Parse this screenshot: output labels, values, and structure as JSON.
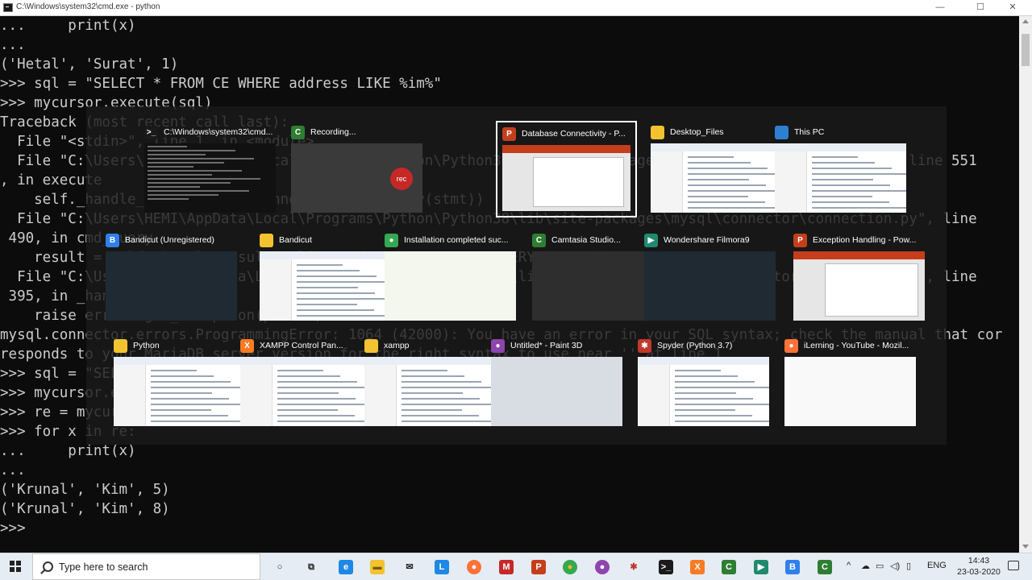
{
  "window": {
    "title": "C:\\Windows\\system32\\cmd.exe - python",
    "controls": {
      "minimize": "—",
      "maximize": "☐",
      "close": "✕"
    }
  },
  "console": {
    "lines": [
      "...     print(x)",
      "...",
      "('Hetal', 'Surat', 1)",
      ">>> sql = \"SELECT * FROM CE WHERE address LIKE %im%\"",
      ">>> mycursor.execute(sql)",
      "Traceback (most recent call last):",
      "  File \"<stdin>\", line 1, in <module>",
      "  File \"C:\\Users\\HEMI\\AppData\\Local\\Programs\\Python\\Python38\\lib\\site-packages\\mysql\\connector\\cursor.py\", line 551",
      ", in execute",
      "    self._handle_result(self._connection.cmd_query(stmt))",
      "  File \"C:\\Users\\HEMI\\AppData\\Local\\Programs\\Python\\Python38\\lib\\site-packages\\mysql\\connector\\connection.py\", line",
      " 490, in cmd_query",
      "    result = self._handle_result(self._send_cmd(ServerCmd.QUERY, query))",
      "  File \"C:\\Users\\HEMI\\AppData\\Local\\Programs\\Python\\Python38\\lib\\site-packages\\mysql\\connector\\connection.py\", line",
      " 395, in _handle_result",
      "    raise errors.get_exception(packet)",
      "mysql.connector.errors.ProgrammingError: 1064 (42000): You have an error in your SQL syntax; check the manual that cor",
      "responds to your MariaDB server version for the right syntax to use near '' at line 1",
      ">>> sql = \"SELECT * FROM CE WHERE address LIKE '%im%'\"",
      ">>> mycursor.execute(sql)",
      ">>> re = mycursor.fetchall()",
      ">>> for x in re:",
      "...     print(x)",
      "...",
      "('Krunal', 'Kim', 5)",
      "('Krunal', 'Kim', 8)",
      ">>>"
    ]
  },
  "switcher": {
    "windows": [
      {
        "label": "C:\\Windows\\system32\\cmd...",
        "icon": "cmd-icon",
        "thumb": "cmd",
        "color": "#1a1a1a",
        "glyph": ">_"
      },
      {
        "label": "Recording...",
        "icon": "camtasia-recorder-icon",
        "thumb": "rec",
        "color": "#2e7d32",
        "glyph": "C"
      },
      {
        "label": "Database Connectivity - P...",
        "icon": "powerpoint-icon",
        "thumb": "ppt",
        "color": "#c43e1c",
        "glyph": "P",
        "selected": true
      },
      {
        "label": "Desktop_Files",
        "icon": "folder-icon",
        "thumb": "white",
        "color": "#f2c230",
        "glyph": ""
      },
      {
        "label": "This PC",
        "icon": "this-pc-icon",
        "thumb": "white",
        "color": "#2f7fd1",
        "glyph": ""
      },
      {
        "label": "Bandicut (Unregistered)",
        "icon": "bandicut-icon",
        "thumb": "dark",
        "color": "#2f80ed",
        "glyph": "B"
      },
      {
        "label": "Bandicut",
        "icon": "folder-icon",
        "thumb": "white",
        "color": "#f2c230",
        "glyph": ""
      },
      {
        "label": "Installation completed suc...",
        "icon": "chrome-icon",
        "thumb": "green",
        "color": "#34a853",
        "glyph": "●"
      },
      {
        "label": "Camtasia Studio...",
        "icon": "camtasia-icon",
        "thumb": "dark2",
        "color": "#2e7d32",
        "glyph": "C"
      },
      {
        "label": "Wondershare Filmora9",
        "icon": "filmora-icon",
        "thumb": "dark",
        "color": "#1f8a70",
        "glyph": "▶"
      },
      {
        "label": "Exception Handling - Pow...",
        "icon": "powerpoint-icon",
        "thumb": "ppt",
        "color": "#c43e1c",
        "glyph": "P"
      },
      {
        "label": "Python",
        "icon": "folder-icon",
        "thumb": "white",
        "color": "#f2c230",
        "glyph": ""
      },
      {
        "label": "XAMPP Control Pan...",
        "icon": "xampp-icon",
        "thumb": "white",
        "color": "#fb7a24",
        "glyph": "X"
      },
      {
        "label": "xampp",
        "icon": "folder-icon",
        "thumb": "white",
        "color": "#f2c230",
        "glyph": ""
      },
      {
        "label": "Untitled* - Paint 3D",
        "icon": "paint3d-icon",
        "thumb": "paint",
        "color": "#8e44ad",
        "glyph": "●"
      },
      {
        "label": "Spyder (Python 3.7)",
        "icon": "spyder-icon",
        "thumb": "white",
        "color": "#c0392b",
        "glyph": "✱"
      },
      {
        "label": "iLerning - YouTube - Mozil...",
        "icon": "firefox-icon",
        "thumb": "yt",
        "color": "#ff7139",
        "glyph": "●"
      }
    ]
  },
  "taskbar": {
    "search_placeholder": "Type here to search",
    "apps": [
      {
        "name": "cortana-icon",
        "glyph": "○",
        "color": "transparent",
        "fg": "#222"
      },
      {
        "name": "task-view-icon",
        "glyph": "⧉",
        "color": "transparent",
        "fg": "#222"
      },
      {
        "name": "edge-icon",
        "glyph": "e",
        "color": "#1e88e5",
        "fg": "#fff"
      },
      {
        "name": "file-explorer-icon",
        "glyph": "▬",
        "color": "#f2c230",
        "fg": "#7a5d00"
      },
      {
        "name": "mail-icon",
        "glyph": "✉",
        "color": "transparent",
        "fg": "#222"
      },
      {
        "name": "lightshot-icon",
        "glyph": "L",
        "color": "#1e88e5",
        "fg": "#fff"
      },
      {
        "name": "firefox-icon",
        "glyph": "●",
        "color": "#ff7139",
        "fg": "#fff"
      },
      {
        "name": "mcafee-icon",
        "glyph": "M",
        "color": "#c62828",
        "fg": "#fff"
      },
      {
        "name": "powerpoint-icon",
        "glyph": "P",
        "color": "#c43e1c",
        "fg": "#fff"
      },
      {
        "name": "chrome-icon",
        "glyph": "●",
        "color": "#34a853",
        "fg": "#fbbc05"
      },
      {
        "name": "paint3d-icon",
        "glyph": "●",
        "color": "#8e44ad",
        "fg": "#fff"
      },
      {
        "name": "spyder-icon",
        "glyph": "✱",
        "color": "transparent",
        "fg": "#c0392b"
      },
      {
        "name": "cmd-icon",
        "glyph": ">_",
        "color": "#1a1a1a",
        "fg": "#fff"
      },
      {
        "name": "xampp-icon",
        "glyph": "X",
        "color": "#fb7a24",
        "fg": "#fff"
      },
      {
        "name": "camtasia-icon",
        "glyph": "C",
        "color": "#2e7d32",
        "fg": "#fff"
      },
      {
        "name": "filmora-icon",
        "glyph": "▶",
        "color": "#1f8a70",
        "fg": "#fff"
      },
      {
        "name": "firefox-icon-2",
        "glyph": "●",
        "color": "#ff7139",
        "fg": "#fff"
      },
      {
        "name": "bandicut-icon",
        "glyph": "B",
        "color": "#2f80ed",
        "fg": "#fff"
      },
      {
        "name": "camtasia-recorder-icon",
        "glyph": "C",
        "color": "#2e7d32",
        "fg": "#fff"
      }
    ],
    "tray": {
      "chevron": "^",
      "language": "ENG",
      "time": "14:43",
      "date": "23-03-2020"
    }
  }
}
